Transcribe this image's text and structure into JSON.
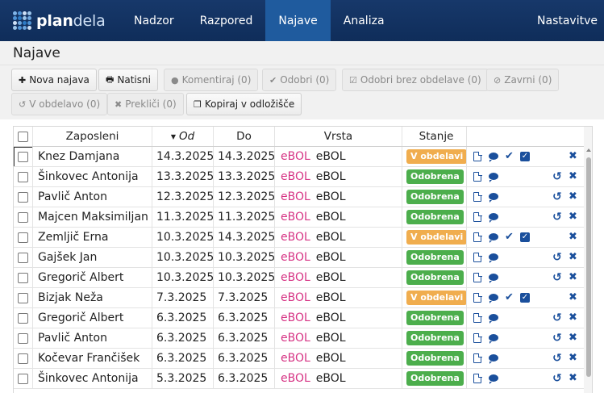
{
  "app": {
    "brand_bold": "plan",
    "brand_light": "dela"
  },
  "nav": {
    "items": [
      {
        "label": "Nadzor"
      },
      {
        "label": "Razpored"
      },
      {
        "label": "Najave"
      },
      {
        "label": "Analiza"
      }
    ],
    "active": "Najave",
    "settings": "Nastavitve"
  },
  "page": {
    "title": "Najave"
  },
  "toolbar": {
    "new": "Nova najava",
    "print": "Natisni",
    "comment": "Komentiraj (0)",
    "approve": "Odobri (0)",
    "approve_no_process": "Odobri brez obdelave (0)",
    "reject": "Zavrni (0)",
    "in_process": "V obdelavo (0)",
    "cancel": "Prekliči (0)",
    "copy_clipboard": "Kopiraj v odložišče"
  },
  "table": {
    "headers": {
      "employee": "Zaposleni",
      "from": "Od",
      "to": "Do",
      "type": "Vrsta",
      "status": "Stanje"
    },
    "rows": [
      {
        "name": "Knez Damjana",
        "od": "14.3.2025",
        "do": "14.3.2025",
        "vrsta_a": "eBOL",
        "vrsta_b": "eBOL",
        "status": "V obdelavi"
      },
      {
        "name": "Šinkovec Antonija",
        "od": "13.3.2025",
        "do": "13.3.2025",
        "vrsta_a": "eBOL",
        "vrsta_b": "eBOL",
        "status": "Odobrena"
      },
      {
        "name": "Pavlič Anton",
        "od": "12.3.2025",
        "do": "12.3.2025",
        "vrsta_a": "eBOL",
        "vrsta_b": "eBOL",
        "status": "Odobrena"
      },
      {
        "name": "Majcen Maksimiljan",
        "od": "11.3.2025",
        "do": "11.3.2025",
        "vrsta_a": "eBOL",
        "vrsta_b": "eBOL",
        "status": "Odobrena"
      },
      {
        "name": "Zemljič Erna",
        "od": "10.3.2025",
        "do": "14.3.2025",
        "vrsta_a": "eBOL",
        "vrsta_b": "eBOL",
        "status": "V obdelavi"
      },
      {
        "name": "Gajšek Jan",
        "od": "10.3.2025",
        "do": "10.3.2025",
        "vrsta_a": "eBOL",
        "vrsta_b": "eBOL",
        "status": "Odobrena"
      },
      {
        "name": "Gregorič Albert",
        "od": "10.3.2025",
        "do": "10.3.2025",
        "vrsta_a": "eBOL",
        "vrsta_b": "eBOL",
        "status": "Odobrena"
      },
      {
        "name": "Bizjak Neža",
        "od": "7.3.2025",
        "do": "7.3.2025",
        "vrsta_a": "eBOL",
        "vrsta_b": "eBOL",
        "status": "V obdelavi"
      },
      {
        "name": "Gregorič Albert",
        "od": "6.3.2025",
        "do": "6.3.2025",
        "vrsta_a": "eBOL",
        "vrsta_b": "eBOL",
        "status": "Odobrena"
      },
      {
        "name": "Pavlič Anton",
        "od": "6.3.2025",
        "do": "6.3.2025",
        "vrsta_a": "eBOL",
        "vrsta_b": "eBOL",
        "status": "Odobrena"
      },
      {
        "name": "Kočevar Frančišek",
        "od": "6.3.2025",
        "do": "6.3.2025",
        "vrsta_a": "eBOL",
        "vrsta_b": "eBOL",
        "status": "Odobrena"
      },
      {
        "name": "Šinkovec Antonija",
        "od": "5.3.2025",
        "do": "6.3.2025",
        "vrsta_a": "eBOL",
        "vrsta_b": "eBOL",
        "status": "Odobrena"
      }
    ]
  },
  "colors": {
    "navbar": "#17386a",
    "nav_active": "#1f5b9e",
    "status_in_process": "#f0ad4e",
    "status_approved": "#4cae4c",
    "type_accent": "#d63384",
    "icon": "#1a4f9c"
  },
  "icons": {
    "new": "plus-icon",
    "print": "print-icon",
    "comment": "comment-icon",
    "approve": "check-icon",
    "approve_no_process": "checkbox-icon",
    "reject": "ban-icon",
    "in_process": "undo-icon",
    "cancel": "times-icon",
    "copy": "copy-icon",
    "row_actions": [
      "document-icon",
      "comment-icon",
      "check-icon",
      "checkbox-icon",
      "undo-icon",
      "close-icon"
    ],
    "sort": "sort-down-icon"
  }
}
